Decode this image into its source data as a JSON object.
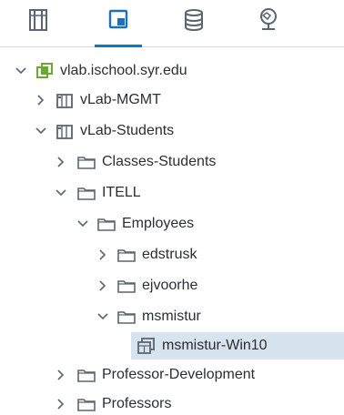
{
  "tabs": [
    {
      "name": "hosts-clusters-tab",
      "icon": "hosts-clusters-icon",
      "active": false
    },
    {
      "name": "vms-templates-tab",
      "icon": "vms-templates-icon",
      "active": true
    },
    {
      "name": "storage-tab",
      "icon": "database-icon",
      "active": false
    },
    {
      "name": "networking-tab",
      "icon": "network-globe-icon",
      "active": false
    }
  ],
  "tree": {
    "root": "vlab.ischool.syr.edu",
    "vlab_mgmt": "vLab-MGMT",
    "vlab_students": "vLab-Students",
    "classes_students": "Classes-Students",
    "itell": "ITELL",
    "employees": "Employees",
    "edstrusk": "edstrusk",
    "ejvoorhe": "ejvoorhe",
    "msmistur": "msmistur",
    "msmistur_vm": "msmistur-Win10",
    "professor_development": "Professor-Development",
    "professors": "Professors"
  },
  "colors": {
    "accent": "#1a73b6",
    "selected_bg": "#d7e3ee",
    "vcenter_green": "#6aab2f",
    "icon_gray": "#5b6570"
  }
}
